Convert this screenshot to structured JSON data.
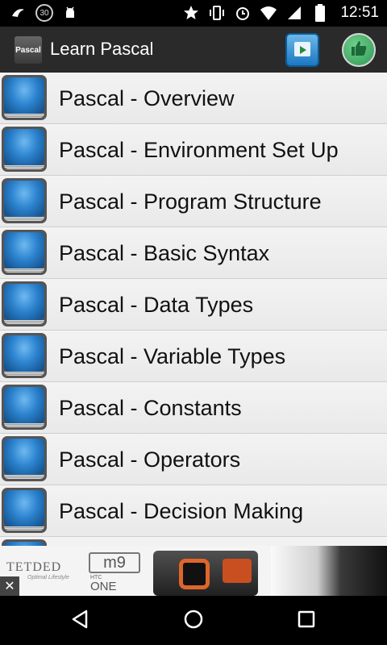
{
  "status_bar": {
    "time": "12:51",
    "notification_count": "30",
    "left_icons": [
      "bird-notification-icon",
      "count-badge-icon",
      "android-debug-icon"
    ],
    "right_icons": [
      "star-icon",
      "vibrate-icon",
      "alarm-icon",
      "wifi-icon",
      "signal-icon",
      "battery-icon"
    ]
  },
  "app_bar": {
    "logo_text": "Pascal",
    "title": "Learn Pascal",
    "actions": [
      "store-icon",
      "thumbs-up-icon"
    ]
  },
  "topics": [
    {
      "label": "Pascal - Overview"
    },
    {
      "label": "Pascal - Environment Set Up"
    },
    {
      "label": "Pascal - Program Structure"
    },
    {
      "label": "Pascal - Basic Syntax"
    },
    {
      "label": "Pascal - Data Types"
    },
    {
      "label": "Pascal - Variable Types"
    },
    {
      "label": "Pascal - Constants"
    },
    {
      "label": "Pascal - Operators"
    },
    {
      "label": "Pascal - Decision Making"
    },
    {
      "label": ""
    }
  ],
  "ad": {
    "brand": "TETDED",
    "tagline": "Optimal Lifestyle",
    "product_badge": "m9",
    "maker": "HTC",
    "model": "ONE",
    "close_label": "✕"
  },
  "nav_bar": {
    "buttons": [
      "back-icon",
      "home-icon",
      "recents-icon"
    ]
  },
  "colors": {
    "app_bar": "#2a2a2a",
    "list_bg": "#ececec",
    "book_blue": "#2c83cf",
    "like_green": "#2e9a56"
  }
}
